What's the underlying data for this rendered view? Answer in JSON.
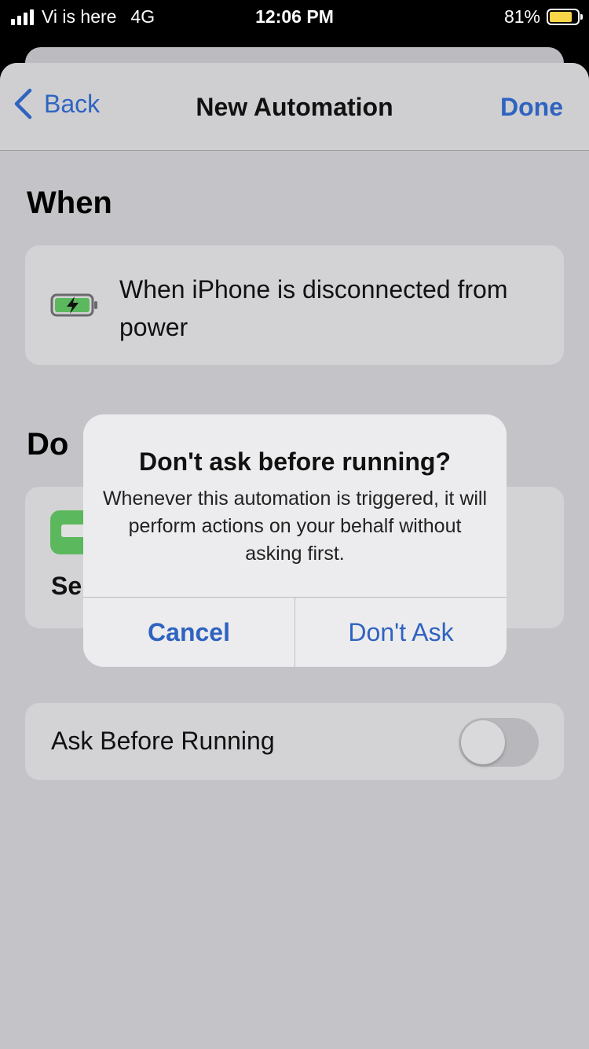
{
  "status_bar": {
    "carrier": "Vi is here",
    "network": "4G",
    "time": "12:06 PM",
    "battery_percent": "81%",
    "battery_level": 0.81
  },
  "nav": {
    "back_label": "Back",
    "title": "New Automation",
    "done_label": "Done"
  },
  "when": {
    "section_title": "When",
    "trigger_text": "When iPhone is disconnected from power",
    "trigger_icon": "battery-charging-icon"
  },
  "do": {
    "section_title": "Do",
    "action_text": "Se",
    "action_icon": "shortcut-action-icon"
  },
  "ask_before_running": {
    "label": "Ask Before Running",
    "enabled": false
  },
  "alert": {
    "title": "Don't ask before running?",
    "message": "Whenever this automation is triggered, it will perform actions on your behalf without asking first.",
    "cancel_label": "Cancel",
    "confirm_label": "Don't Ask"
  },
  "colors": {
    "accent": "#2f63c0",
    "battery_yellow": "#f7d547",
    "action_green": "#5cb85c"
  }
}
